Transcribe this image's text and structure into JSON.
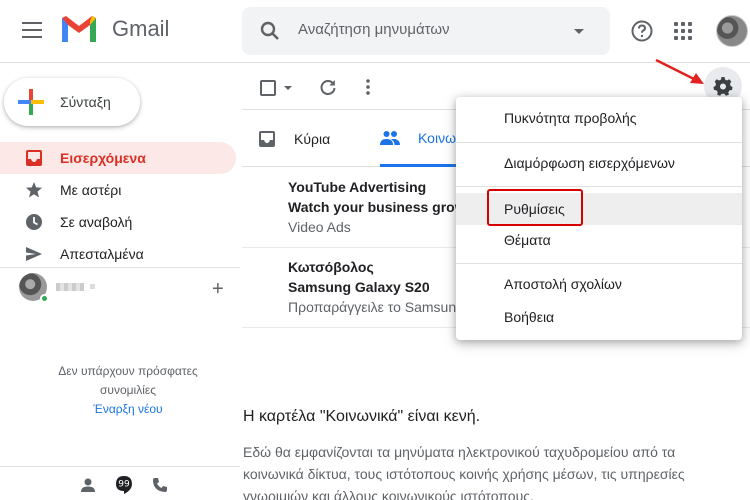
{
  "header": {
    "app_name": "Gmail",
    "search_placeholder": "Αναζήτηση μηνυμάτων"
  },
  "sidebar": {
    "compose_label": "Σύνταξη",
    "items": [
      {
        "label": "Εισερχόμενα",
        "icon": "inbox-icon",
        "active": true
      },
      {
        "label": "Με αστέρι",
        "icon": "star-icon",
        "active": false
      },
      {
        "label": "Σε αναβολή",
        "icon": "clock-icon",
        "active": false
      },
      {
        "label": "Απεσταλμένα",
        "icon": "send-icon",
        "active": false
      }
    ],
    "no_conversations_line1": "Δεν υπάρχουν πρόσφατες",
    "no_conversations_line2": "συνομιλίες",
    "start_new": "Έναρξη νέου"
  },
  "tabs": [
    {
      "label": "Κύρια",
      "icon": "inbox-tab-icon"
    },
    {
      "label": "Κοινω",
      "icon": "people-icon",
      "active": true
    }
  ],
  "emails": [
    {
      "sender": "YouTube Advertising",
      "subject": "Watch your business grow",
      "snippet": "Video Ads"
    },
    {
      "sender": "Κωτσόβολος",
      "subject": "Samsung Galaxy S20",
      "snippet": "Προπαράγγειλε το Samsung"
    }
  ],
  "empty_state": {
    "title": "Η καρτέλα \"Κοινωνικά\" είναι κενή.",
    "line1": "Εδώ θα εμφανίζονται τα μηνύματα ηλεκτρονικού ταχυδρομείου από τα",
    "line2": "κοινωνικά δίκτυα, τους ιστότοπους κοινής χρήσης μέσων, τις υπηρεσίες",
    "line3": "γνωριμιών και άλλους κοινωνικούς ιστότοπους."
  },
  "settings_menu": {
    "items": [
      "Πυκνότητα προβολής",
      "Διαμόρφωση εισερχόμενων",
      "Ρυθμίσεις",
      "Θέματα",
      "Αποστολή σχολίων",
      "Βοήθεια"
    ],
    "highlighted": "Ρυθμίσεις"
  },
  "colors": {
    "accent_red": "#d93025",
    "accent_blue": "#1a73e8",
    "annotation_red": "#d50000"
  }
}
